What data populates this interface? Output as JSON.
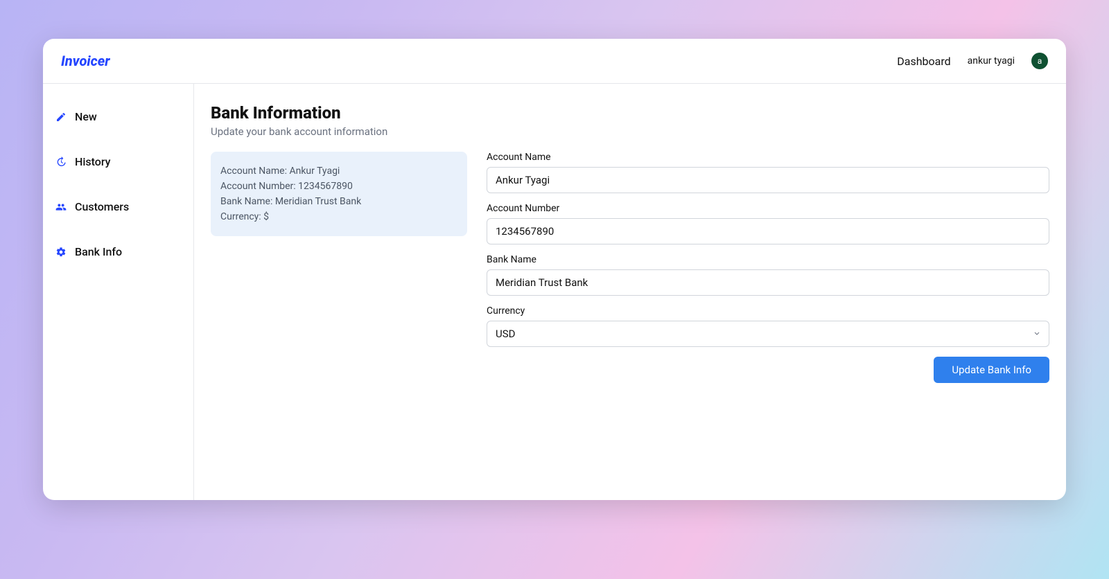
{
  "brand": "Invoicer",
  "top": {
    "dashboard": "Dashboard",
    "username": "ankur tyagi",
    "avatar_initial": "a"
  },
  "sidebar": {
    "items": [
      {
        "label": "New"
      },
      {
        "label": "History"
      },
      {
        "label": "Customers"
      },
      {
        "label": "Bank Info"
      }
    ]
  },
  "page": {
    "title": "Bank Information",
    "subtitle": "Update your bank account information"
  },
  "summary": {
    "account_name_label": "Account Name: ",
    "account_name_value": "Ankur Tyagi",
    "account_number_label": "Account Number: ",
    "account_number_value": "1234567890",
    "bank_name_label": "Bank Name: ",
    "bank_name_value": "Meridian Trust Bank",
    "currency_label": "Currency: ",
    "currency_value": "$"
  },
  "form": {
    "account_name": {
      "label": "Account Name",
      "value": "Ankur Tyagi"
    },
    "account_number": {
      "label": "Account Number",
      "value": "1234567890"
    },
    "bank_name": {
      "label": "Bank Name",
      "value": "Meridian Trust Bank"
    },
    "currency": {
      "label": "Currency",
      "selected": "USD"
    },
    "submit_label": "Update Bank Info"
  }
}
